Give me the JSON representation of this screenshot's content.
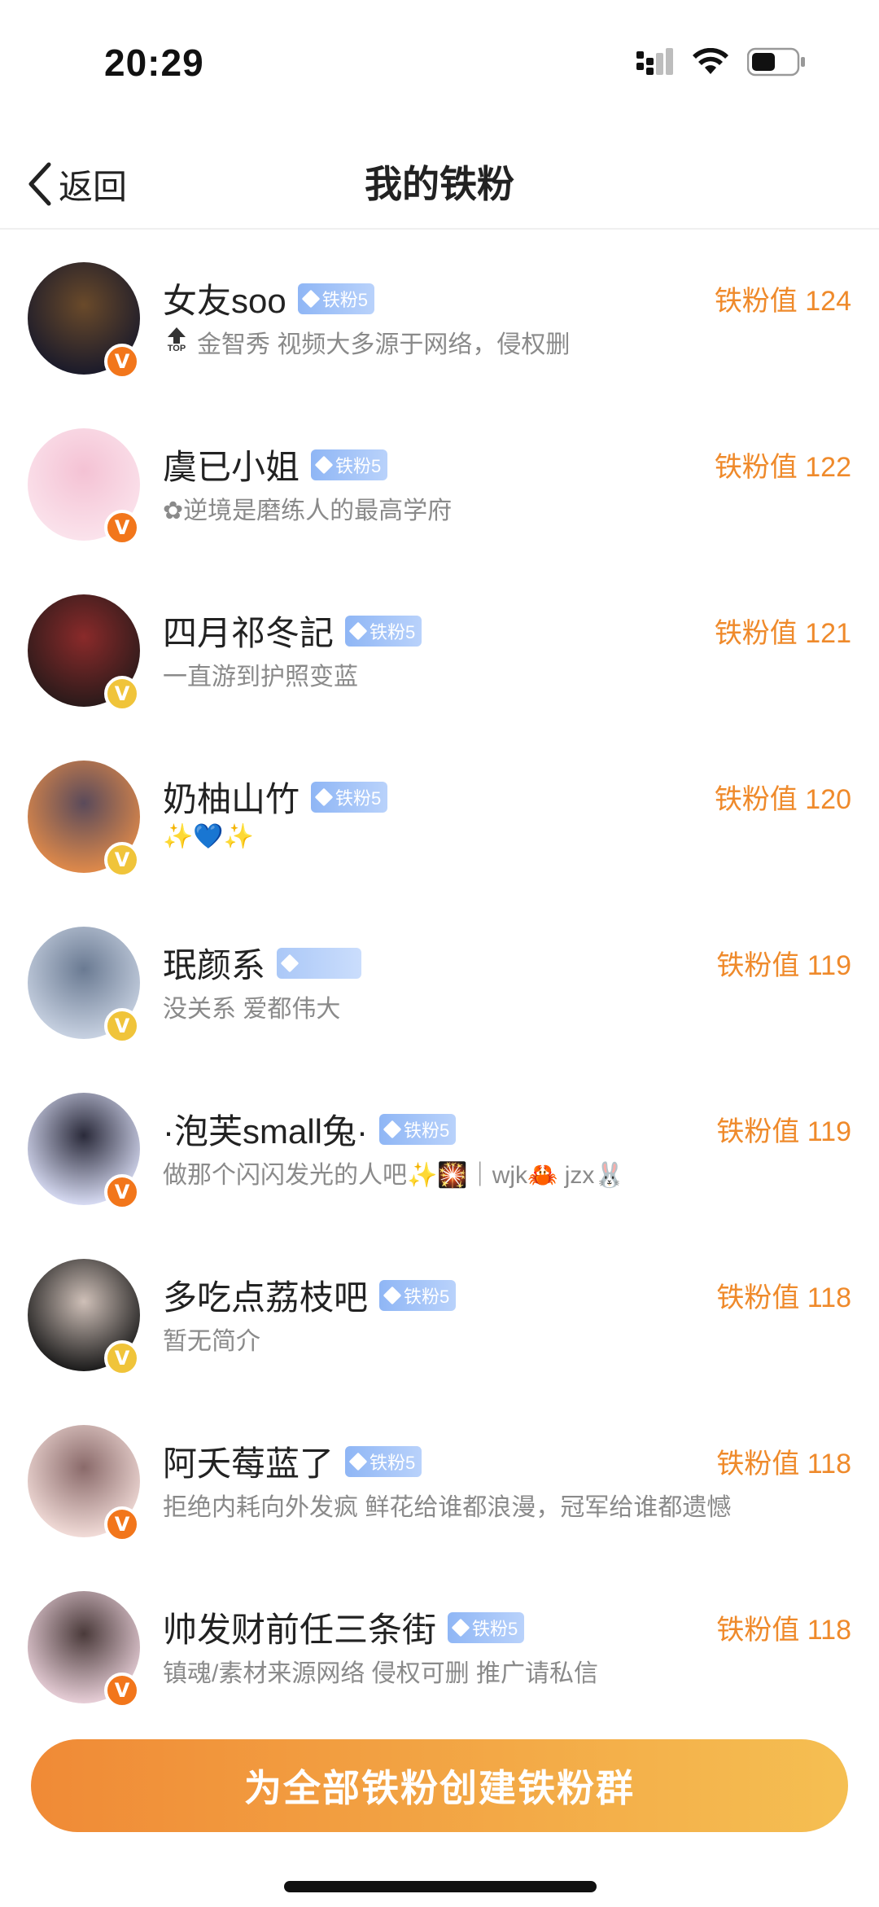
{
  "status_bar": {
    "time": "20:29"
  },
  "nav": {
    "back_label": "返回",
    "title": "我的铁粉"
  },
  "fans": [
    {
      "name": "女友soo",
      "badge": "铁粉5",
      "score": "铁粉值 124",
      "bio": "金智秀 视频大多源于网络，侵权删",
      "top_label": "TOP",
      "v_color": "orange",
      "avatar_colors": [
        "#1a1a2a",
        "#6a4a2a"
      ]
    },
    {
      "name": "虞已小姐",
      "badge": "铁粉5",
      "score": "铁粉值 122",
      "bio": "✿逆境是磨练人的最高学府",
      "v_color": "orange",
      "avatar_colors": [
        "#fbe3ec",
        "#f4c2d4"
      ]
    },
    {
      "name": "四月祁冬記",
      "badge": "铁粉5",
      "score": "铁粉值 121",
      "bio": "一直游到护照变蓝",
      "v_color": "yellow",
      "avatar_colors": [
        "#2a1a1a",
        "#8a2a2a"
      ]
    },
    {
      "name": "奶柚山竹",
      "badge": "铁粉5",
      "score": "铁粉值 120",
      "bio": "✨💙✨",
      "v_color": "yellow",
      "avatar_colors": [
        "#e08a4a",
        "#5a4a5a"
      ]
    },
    {
      "name": "珉颜系",
      "badge": "",
      "score": "铁粉值 119",
      "bio": "没关系 爱都伟大",
      "v_color": "yellow",
      "avatar_colors": [
        "#c8d2e2",
        "#6a7a92"
      ]
    },
    {
      "name": "·泡芙small兔·",
      "badge": "铁粉5",
      "score": "铁粉值 119",
      "bio": "做那个闪闪发光的人吧✨🎇｜wjk🦀 jzx🐰",
      "v_color": "orange",
      "avatar_colors": [
        "#d8dcf4",
        "#2a2a3a"
      ]
    },
    {
      "name": "多吃点荔枝吧",
      "badge": "铁粉5",
      "score": "铁粉值 118",
      "bio": "暂无简介",
      "v_color": "yellow",
      "avatar_colors": [
        "#1a1a1a",
        "#cfc0b8"
      ]
    },
    {
      "name": "阿夭莓蓝了",
      "badge": "铁粉5",
      "score": "铁粉值 118",
      "bio": "拒绝内耗向外发疯 鲜花给谁都浪漫，冠军给谁都遗憾",
      "v_color": "orange",
      "avatar_colors": [
        "#f2dcd8",
        "#8a6a6a"
      ]
    },
    {
      "name": "帅发财前任三条街",
      "badge": "铁粉5",
      "score": "铁粉值 118",
      "bio": "镇魂/素材来源网络 侵权可删 推广请私信",
      "v_color": "orange",
      "avatar_colors": [
        "#e8cfd8",
        "#4a3a3a"
      ]
    }
  ],
  "create_group_label": "为全部铁粉创建铁粉群",
  "colors": {
    "accent": "#ef8a2b",
    "badge_blue": "#8fb6f5"
  }
}
